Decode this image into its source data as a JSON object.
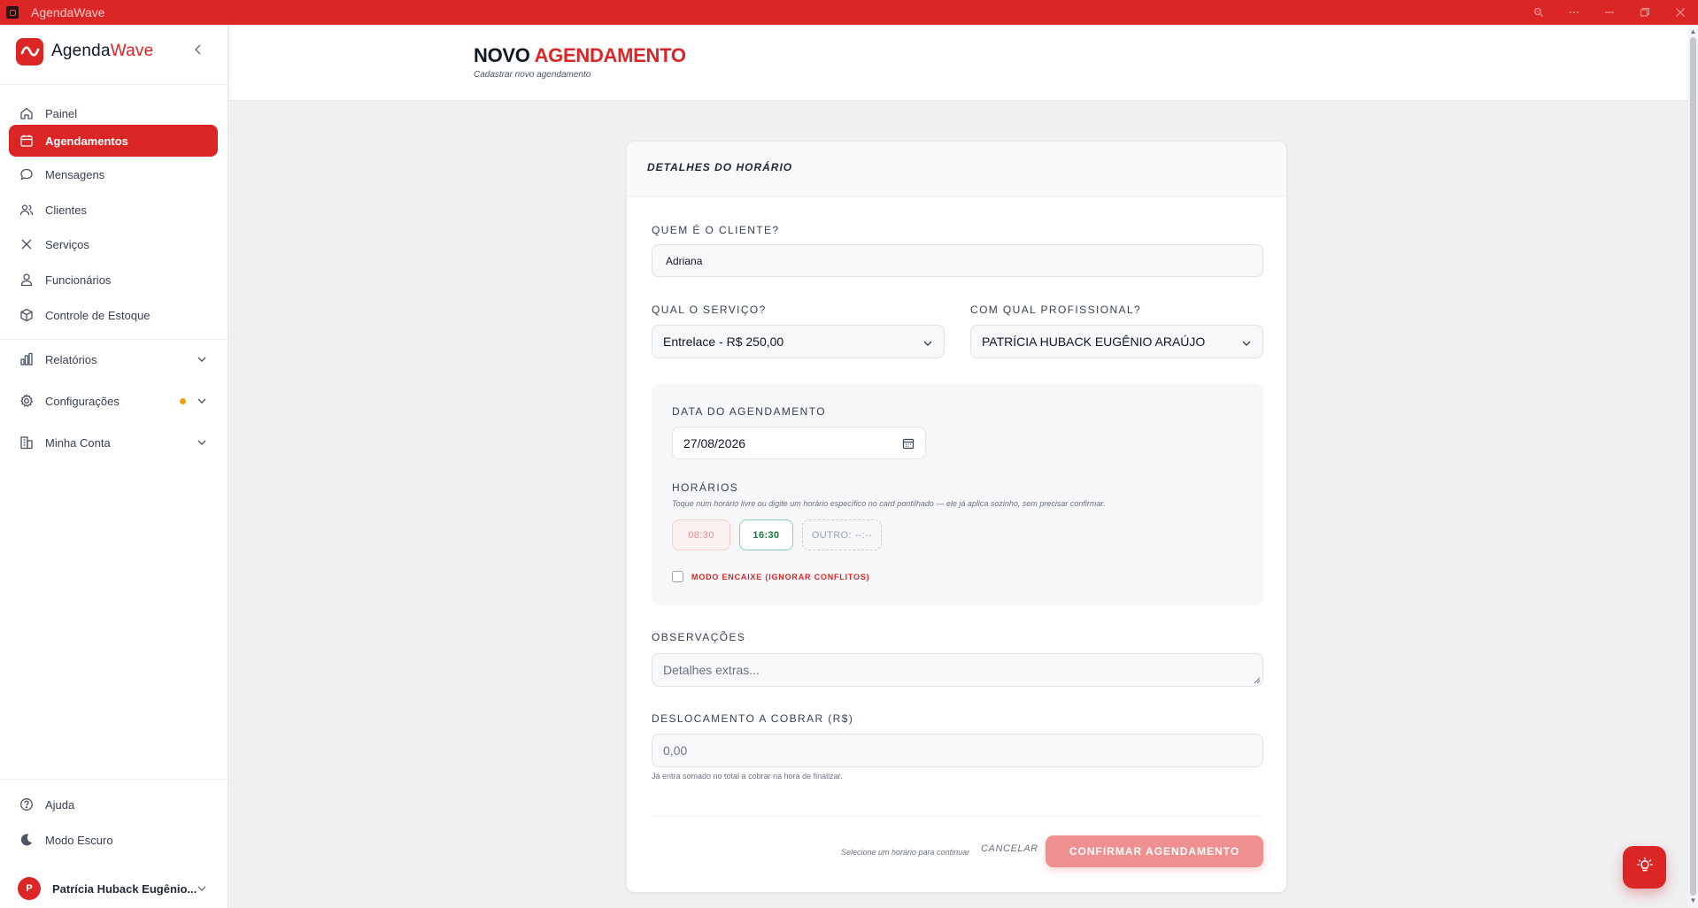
{
  "window": {
    "title": "AgendaWave",
    "controls": [
      "zoom-icon",
      "more-icon",
      "minimize-icon",
      "restore-icon",
      "close-icon"
    ]
  },
  "brand": {
    "name_part1": "Agenda",
    "name_part2": "Wave"
  },
  "sidebar": {
    "items": [
      {
        "label": "Painel",
        "icon": "home-icon",
        "active": false
      },
      {
        "label": "Agendamentos",
        "icon": "calendar-icon",
        "active": true
      },
      {
        "label": "Mensagens",
        "icon": "message-icon",
        "active": false
      },
      {
        "label": "Clientes",
        "icon": "users-icon",
        "active": false
      },
      {
        "label": "Serviços",
        "icon": "scissors-icon",
        "active": false
      },
      {
        "label": "Funcionários",
        "icon": "user-icon",
        "active": false
      },
      {
        "label": "Controle de Estoque",
        "icon": "box-icon",
        "active": false
      },
      {
        "label": "Relatórios",
        "icon": "bar-chart-icon",
        "expandable": true
      },
      {
        "label": "Configurações",
        "icon": "gear-icon",
        "expandable": true,
        "badge_color": "#f59e0b"
      },
      {
        "label": "Minha Conta",
        "icon": "building-icon",
        "expandable": true
      }
    ],
    "bottom": [
      {
        "label": "Ajuda",
        "icon": "help-icon"
      },
      {
        "label": "Modo Escuro",
        "icon": "moon-icon"
      }
    ],
    "user": {
      "initial": "P",
      "name": "Patrícia Huback Eugênio..."
    }
  },
  "header": {
    "title_part1": "NOVO",
    "title_part2": "AGENDAMENTO",
    "subtitle": "Cadastrar novo agendamento"
  },
  "form": {
    "section_title": "DETALHES DO HORÁRIO",
    "client_label": "QUEM É O CLIENTE?",
    "client_value": "Adriana",
    "service_label": "QUAL O SERVIÇO?",
    "service_value": "Entrelace - R$ 250,00",
    "professional_label": "COM QUAL PROFISSIONAL?",
    "professional_value": "PATRÍCIA HUBACK EUGÊNIO ARAÚJO",
    "date_label": "DATA DO AGENDAMENTO",
    "date_value": "27/08/2026",
    "times_label": "HORÁRIOS",
    "times_hint": "Toque num horário livre ou digite um horário específico no card pontilhado — ele já aplica sozinho, sem precisar confirmar.",
    "slots": [
      {
        "time": "08:30",
        "status": "busy"
      },
      {
        "time": "16:30",
        "status": "free"
      }
    ],
    "other_slot": "OUTRO: --:--",
    "fit_mode_label": "MODO ENCAIXE (IGNORAR CONFLITOS)",
    "fit_mode_checked": false,
    "notes_label": "OBSERVAÇÕES",
    "notes_placeholder": "Detalhes extras...",
    "travel_label": "DESLOCAMENTO A COBRAR (R$)",
    "travel_placeholder": "0,00",
    "travel_hint": "Já entra somado no total a cobrar na hora de finalizar.",
    "footer_hint": "Selecione um horário para continuar",
    "cancel_label": "CANCELAR",
    "confirm_label": "CONFIRMAR AGENDAMENTO"
  },
  "colors": {
    "accent": "#dc2626",
    "slot_busy": "#e08a8a",
    "slot_free": "#15803d",
    "confirm_disabled": "#ef8f8f"
  },
  "fab": {
    "icon": "lightbulb-icon"
  }
}
